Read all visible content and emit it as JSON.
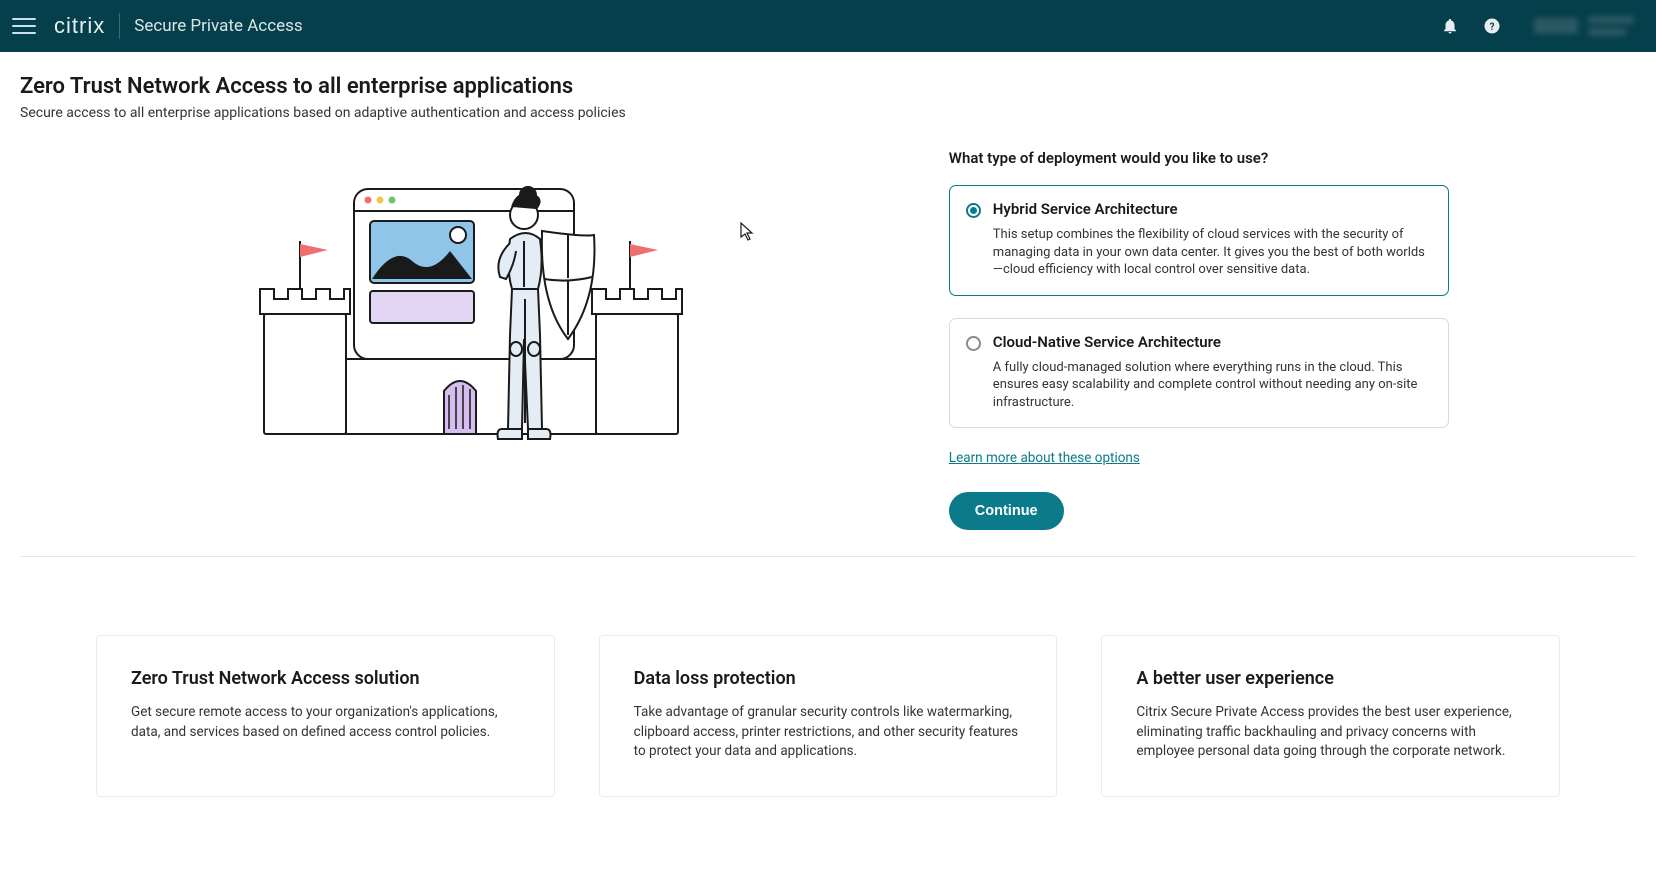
{
  "header": {
    "brand": "citrix",
    "product": "Secure Private Access"
  },
  "page": {
    "title": "Zero Trust Network Access to all enterprise applications",
    "subtitle": "Secure access to all enterprise applications based on adaptive authentication and access policies"
  },
  "deployment": {
    "question": "What type of deployment would you like to use?",
    "options": [
      {
        "title": "Hybrid Service Architecture",
        "description": "This setup combines the flexibility of cloud services with the security of managing data in your own data center. It gives you the best of both worlds—cloud efficiency with local control over sensitive data.",
        "selected": true
      },
      {
        "title": "Cloud-Native Service Architecture",
        "description": "A fully cloud-managed solution where everything runs in the cloud. This ensures easy scalability and complete control without needing any on-site infrastructure.",
        "selected": false
      }
    ],
    "learn_more": "Learn more about these options",
    "continue": "Continue"
  },
  "features": [
    {
      "title": "Zero Trust Network Access solution",
      "body": "Get secure remote access to your organization's applications, data, and services based on defined access control policies."
    },
    {
      "title": "Data loss protection",
      "body": "Take advantage of granular security controls like watermarking, clipboard access, printer restrictions, and other security features to protect your data and applications."
    },
    {
      "title": "A better user experience",
      "body": "Citrix Secure Private Access provides the best user experience, eliminating traffic backhauling and privacy concerns with employee personal data going through the corporate network."
    }
  ]
}
